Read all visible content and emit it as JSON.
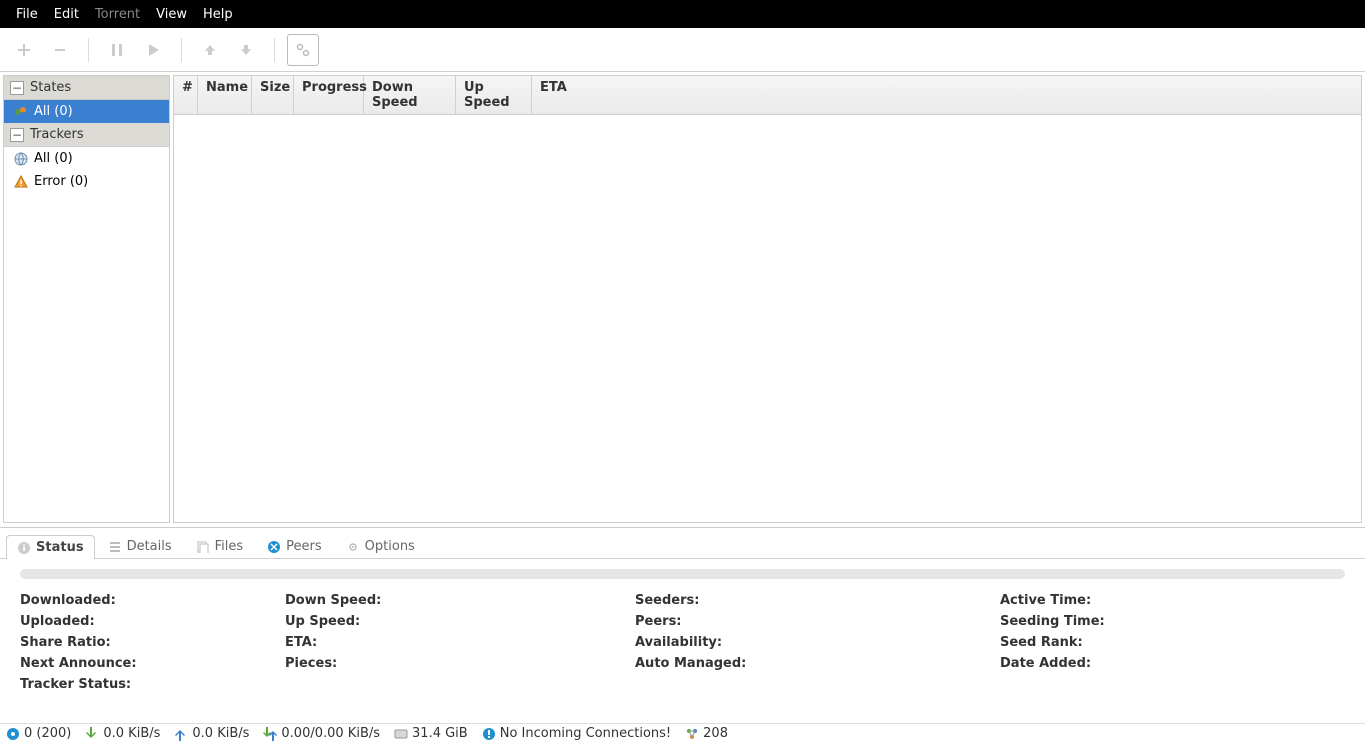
{
  "menu": {
    "file": "File",
    "edit": "Edit",
    "torrent": "Torrent",
    "view": "View",
    "help": "Help"
  },
  "sidebar": {
    "states_header": "States",
    "states_all": "All (0)",
    "trackers_header": "Trackers",
    "trackers_all": "All (0)",
    "trackers_error": "Error (0)"
  },
  "columns": {
    "num": "#",
    "name": "Name",
    "size": "Size",
    "progress": "Progress",
    "down": "Down Speed",
    "up": "Up Speed",
    "eta": "ETA"
  },
  "tabs": {
    "status": "Status",
    "details": "Details",
    "files": "Files",
    "peers": "Peers",
    "options": "Options"
  },
  "status": {
    "downloaded": "Downloaded:",
    "uploaded": "Uploaded:",
    "share_ratio": "Share Ratio:",
    "next_announce": "Next Announce:",
    "tracker_status": "Tracker Status:",
    "down_speed": "Down Speed:",
    "up_speed": "Up Speed:",
    "eta": "ETA:",
    "pieces": "Pieces:",
    "seeders": "Seeders:",
    "peers": "Peers:",
    "availability": "Availability:",
    "auto_managed": "Auto Managed:",
    "active_time": "Active Time:",
    "seeding_time": "Seeding Time:",
    "seed_rank": "Seed Rank:",
    "date_added": "Date Added:"
  },
  "statusbar": {
    "connections": "0 (200)",
    "down_rate": "0.0 KiB/s",
    "up_rate": "0.0 KiB/s",
    "protocol": "0.00/0.00 KiB/s",
    "disk": "31.4 GiB",
    "warning": "No Incoming Connections!",
    "dht": "208"
  }
}
